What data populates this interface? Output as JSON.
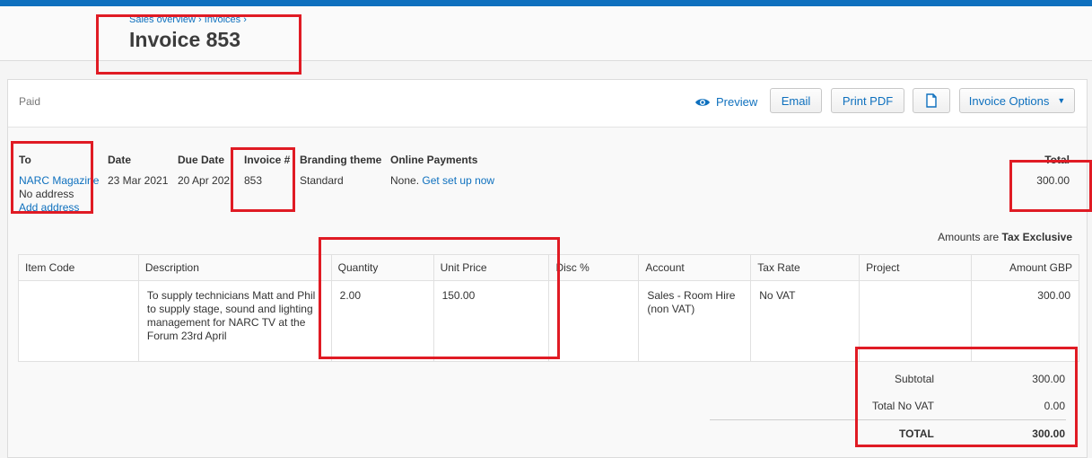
{
  "breadcrumb": [
    "Sales overview",
    "Invoices"
  ],
  "breadcrumb_sep": "›",
  "page_title": "Invoice 853",
  "status": "Paid",
  "toolbar": {
    "preview_label": "Preview",
    "email_label": "Email",
    "print_label": "Print PDF",
    "options_label": "Invoice Options",
    "preview_icon": "eye-icon",
    "copy_icon": "copy-icon",
    "caret_icon": "caret-down-icon"
  },
  "details": {
    "to_label": "To",
    "to_name": "NARC Magazine",
    "to_address": "No address",
    "add_address": "Add address",
    "date_label": "Date",
    "date": "23 Mar 2021",
    "due_label": "Due Date",
    "due": "20 Apr 2021",
    "invoice_no_label": "Invoice #",
    "invoice_no": "853",
    "branding_label": "Branding theme",
    "branding": "Standard",
    "online_label": "Online Payments",
    "online_value": "None.",
    "online_link": "Get set up now",
    "total_label": "Total",
    "total": "300.00"
  },
  "amounts_note": {
    "prefix": "Amounts are",
    "value": "Tax Exclusive"
  },
  "table": {
    "headers": [
      "Item Code",
      "Description",
      "Quantity",
      "Unit Price",
      "Disc %",
      "Account",
      "Tax Rate",
      "Project",
      "Amount GBP"
    ],
    "rows": [
      {
        "item_code": "",
        "description": "To supply technicians Matt and Phil to supply stage, sound and lighting management for NARC TV at the Forum 23rd April",
        "quantity": "2.00",
        "unit_price": "150.00",
        "disc": "",
        "account": "Sales - Room Hire (non VAT)",
        "tax_rate": "No VAT",
        "project": "",
        "amount": "300.00"
      }
    ]
  },
  "totals": {
    "subtotal_label": "Subtotal",
    "subtotal": "300.00",
    "novat_label": "Total No VAT",
    "novat": "0.00",
    "total_label": "TOTAL",
    "total": "300.00"
  },
  "colors": {
    "accent": "#0e70be",
    "highlight": "#e01b24"
  }
}
